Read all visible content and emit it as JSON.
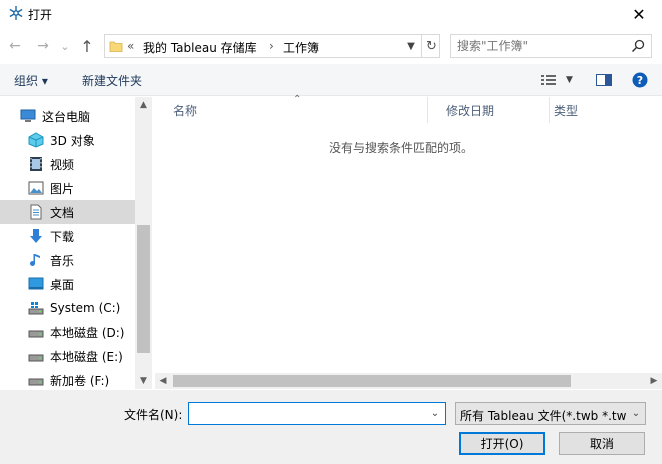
{
  "window": {
    "title": "打开",
    "close_glyph": "✕",
    "app_icon": "snowflake-gear-icon"
  },
  "nav": {
    "back_glyph": "←",
    "forward_glyph": "→",
    "recent_glyph": "⌄",
    "up_glyph": "↑",
    "breadcrumb_prefix": "«",
    "breadcrumb_parent": "我的 Tableau 存储库",
    "breadcrumb_sep": "›",
    "breadcrumb_current": "工作簿",
    "search_placeholder": "搜索\"工作簿\""
  },
  "toolbar": {
    "organize_label": "组织 ▾",
    "new_folder_label": "新建文件夹"
  },
  "sidebar": {
    "items": [
      {
        "label": "这台电脑",
        "icon": "computer-icon"
      },
      {
        "label": "3D 对象",
        "icon": "3d-objects-icon"
      },
      {
        "label": "视频",
        "icon": "video-icon"
      },
      {
        "label": "图片",
        "icon": "pictures-icon"
      },
      {
        "label": "文档",
        "icon": "documents-icon"
      },
      {
        "label": "下载",
        "icon": "download-icon"
      },
      {
        "label": "音乐",
        "icon": "music-icon"
      },
      {
        "label": "桌面",
        "icon": "desktop-icon"
      },
      {
        "label": "System (C:)",
        "icon": "system-drive-icon"
      },
      {
        "label": "本地磁盘 (D:)",
        "icon": "drive-icon"
      },
      {
        "label": "本地磁盘 (E:)",
        "icon": "drive-icon"
      },
      {
        "label": "新加卷 (F:)",
        "icon": "drive-icon"
      }
    ],
    "selected_index": 4
  },
  "filelist": {
    "columns": [
      "名称",
      "修改日期",
      "类型"
    ],
    "empty_message": "没有与搜索条件匹配的项。"
  },
  "bottom": {
    "filename_label": "文件名(N):",
    "filename_value": "",
    "filter_value": "所有 Tableau 文件(*.twb *.twbx",
    "open_label": "打开(O)",
    "cancel_label": "取消"
  },
  "colors": {
    "accent": "#0078d7",
    "selected_bg": "#d9d9d9",
    "toolbar_bg": "#f5f6f7"
  }
}
